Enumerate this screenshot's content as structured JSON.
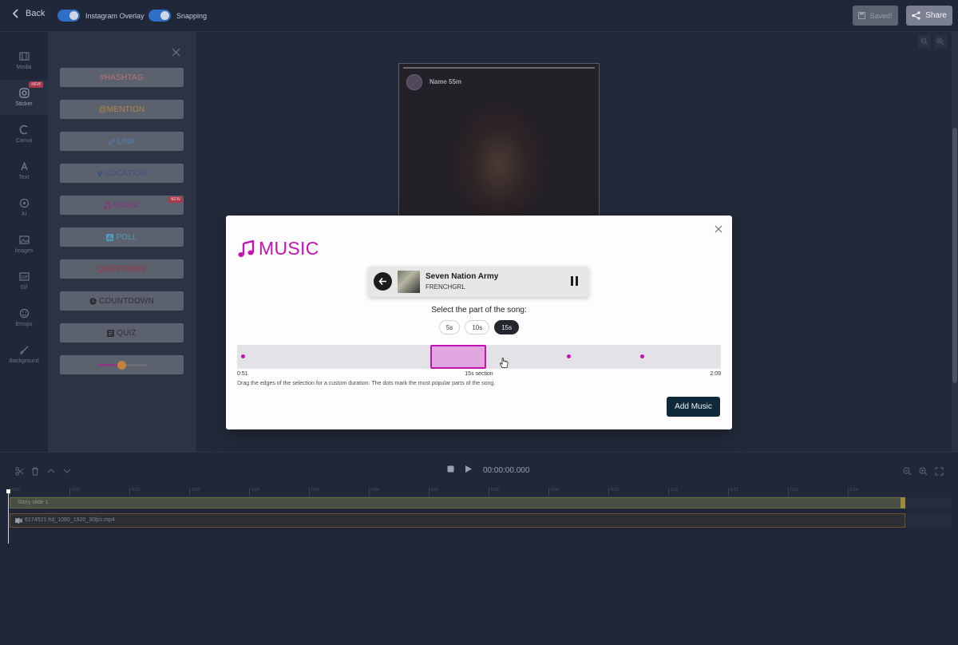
{
  "topbar": {
    "back_label": "Back",
    "toggle_overlay_label": "Instagram Overlay",
    "toggle_snapping_label": "Snapping",
    "saved_label": "Saved!",
    "share_label": "Share"
  },
  "rail": {
    "items": [
      {
        "label": "Media",
        "icon": "film-icon"
      },
      {
        "label": "Sticker",
        "icon": "instagram-icon",
        "badge": "NEW"
      },
      {
        "label": "Canva",
        "icon": "canva-icon"
      },
      {
        "label": "Text",
        "icon": "text-icon"
      },
      {
        "label": "AI",
        "icon": "ai-icon"
      },
      {
        "label": "Images",
        "icon": "image-icon"
      },
      {
        "label": "Gif",
        "icon": "gif-icon"
      },
      {
        "label": "Emojis",
        "icon": "emoji-icon"
      },
      {
        "label": "Background",
        "icon": "brush-icon"
      }
    ]
  },
  "stickers": {
    "items": [
      {
        "label": "#HASHTAG",
        "color": "#c0707a"
      },
      {
        "label": "@MENTION",
        "color": "#b8864a"
      },
      {
        "label": "LINK",
        "color": "#4f7fb8",
        "icon": "link-icon"
      },
      {
        "label": "LOCATION",
        "color": "#3c4d86",
        "icon": "pin-icon"
      },
      {
        "label": "MUSIC",
        "color": "#8a2f80",
        "icon": "music-icon",
        "badge": "NEW"
      },
      {
        "label": "POLL",
        "color": "#4f9bb8",
        "icon": "poll-icon"
      },
      {
        "label": "QUESTIONS",
        "color": "#a8304a"
      },
      {
        "label": "COUNTDOWN",
        "color": "#2c2f38",
        "icon": "clock-icon"
      },
      {
        "label": "QUIZ",
        "color": "#2c2f38",
        "icon": "quiz-icon"
      }
    ],
    "emoji_slider_level": 0.5
  },
  "story": {
    "name": "Name 55m"
  },
  "modal": {
    "title": "MUSIC",
    "song_title": "Seven Nation Army",
    "song_artist": "FRENCHGRL",
    "select_label": "Select the part of the song:",
    "durations": [
      "5s",
      "10s",
      "15s"
    ],
    "active_duration": "15s",
    "start_time": "0:51",
    "section_label": "15s section",
    "end_time": "2:09",
    "hint": "Drag the edges of the selection for a custom duration. The dots mark the most popular parts of the song.",
    "add_button": "Add Music",
    "accent": "#c312b4",
    "selection": {
      "start_fraction": 0.4,
      "end_fraction": 0.515
    },
    "popular_dots": [
      0.012,
      0.685,
      0.837
    ]
  },
  "timeline": {
    "timecode": "00:00:00.000",
    "ticks": [
      "0:00",
      "0:01",
      "0:02",
      "0:03",
      "0:04",
      "0:05",
      "0:06",
      "0:07",
      "0:08",
      "0:09",
      "0:10",
      "0:11",
      "0:12",
      "0:13",
      "0:14"
    ],
    "track1_label": "Story slide 1",
    "track2_label": "6174521-hd_1080_1920_30fps.mp4"
  }
}
